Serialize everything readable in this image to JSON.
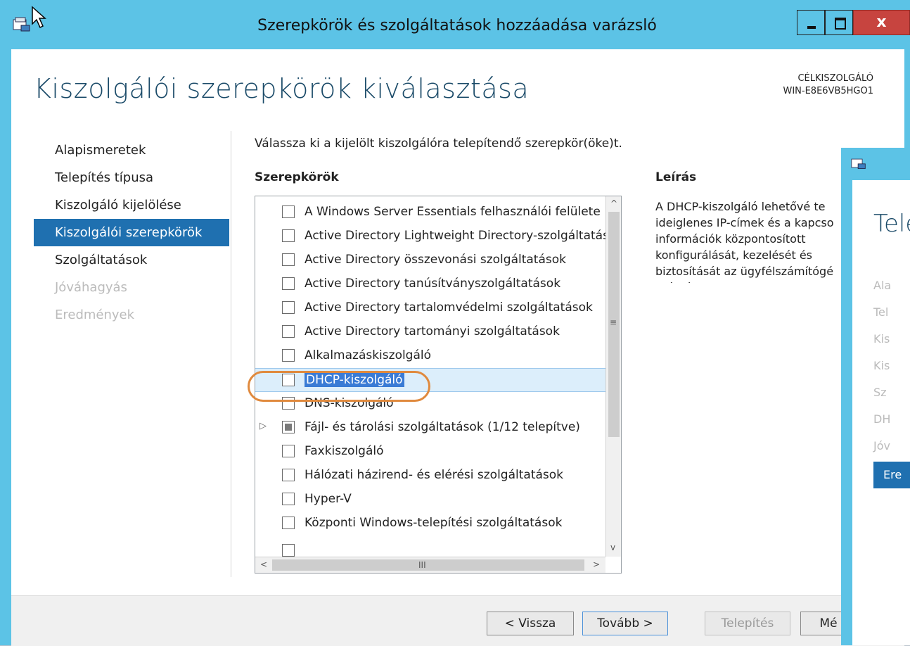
{
  "window": {
    "title": "Szerepkörök és szolgáltatások hozzáadása varázsló",
    "min_glyph": "",
    "max_glyph": "",
    "close_glyph": "x"
  },
  "page": {
    "title": "Kiszolgálói szerepkörök kiválasztása",
    "target_label": "CÉLKISZOLGÁLÓ",
    "target_name": "WIN-E8E6VB5HGO1"
  },
  "nav": {
    "items": [
      {
        "label": "Alapismeretek",
        "state": "normal"
      },
      {
        "label": "Telepítés típusa",
        "state": "normal"
      },
      {
        "label": "Kiszolgáló kijelölése",
        "state": "normal"
      },
      {
        "label": "Kiszolgálói szerepkörök",
        "state": "active"
      },
      {
        "label": "Szolgáltatások",
        "state": "normal"
      },
      {
        "label": "Jóváhagyás",
        "state": "disabled"
      },
      {
        "label": "Eredmények",
        "state": "disabled"
      }
    ]
  },
  "main": {
    "instruction": "Válassza ki a kijelölt kiszolgálóra telepítendő szerepkör(öke)t.",
    "roles_header": "Szerepkörök",
    "description_header": "Leírás",
    "description_text": "A DHCP-kiszolgáló lehetővé te\nideiglenes IP-címek és a kapcso\ninformációk központosított\nkonfigurálását, kezelését és\nbiztosítását az ügyfélszámítógé\nszámára.",
    "roles": [
      {
        "label": "A Windows Server Essentials felhasználói felülete",
        "state": "unchecked",
        "selected": false,
        "expandable": false
      },
      {
        "label": "Active Directory Lightweight Directory-szolgáltatások",
        "state": "unchecked",
        "selected": false,
        "expandable": false
      },
      {
        "label": "Active Directory összevonási szolgáltatások",
        "state": "unchecked",
        "selected": false,
        "expandable": false
      },
      {
        "label": "Active Directory tanúsítványszolgáltatások",
        "state": "unchecked",
        "selected": false,
        "expandable": false
      },
      {
        "label": "Active Directory tartalomvédelmi szolgáltatások",
        "state": "unchecked",
        "selected": false,
        "expandable": false
      },
      {
        "label": "Active Directory tartományi szolgáltatások",
        "state": "unchecked",
        "selected": false,
        "expandable": false
      },
      {
        "label": "Alkalmazáskiszolgáló",
        "state": "unchecked",
        "selected": false,
        "expandable": false
      },
      {
        "label": "DHCP-kiszolgáló",
        "state": "unchecked",
        "selected": true,
        "expandable": false
      },
      {
        "label": "DNS-kiszolgáló",
        "state": "unchecked",
        "selected": false,
        "expandable": false
      },
      {
        "label": "Fájl- és tárolási szolgáltatások (1/12 telepítve)",
        "state": "partial",
        "selected": false,
        "expandable": true
      },
      {
        "label": "Faxkiszolgáló",
        "state": "unchecked",
        "selected": false,
        "expandable": false
      },
      {
        "label": "Hálózati házirend- és elérési szolgáltatások",
        "state": "unchecked",
        "selected": false,
        "expandable": false
      },
      {
        "label": "Hyper-V",
        "state": "unchecked",
        "selected": false,
        "expandable": false
      },
      {
        "label": "Központi Windows-telepítési szolgáltatások",
        "state": "unchecked",
        "selected": false,
        "expandable": false
      }
    ],
    "scroll_up": "^",
    "scroll_down": "v",
    "scroll_left": "<",
    "scroll_right": ">",
    "scroll_grip": "≡",
    "hscroll_grip": "III",
    "expander_glyph": "▷"
  },
  "buttons": {
    "back": "< Vissza",
    "next": "Tovább >",
    "install": "Telepítés",
    "cancel": "Mé"
  },
  "second_window": {
    "title": "Tele",
    "items": [
      "Ala",
      "Tel",
      "Kis",
      "Kis",
      "Sz",
      "DH",
      "Jóv",
      "Ere"
    ]
  },
  "colors": {
    "titlebar": "#5cc3e6",
    "accent": "#1f70b0",
    "close": "#c7443f",
    "annotation": "#e08a3e"
  }
}
